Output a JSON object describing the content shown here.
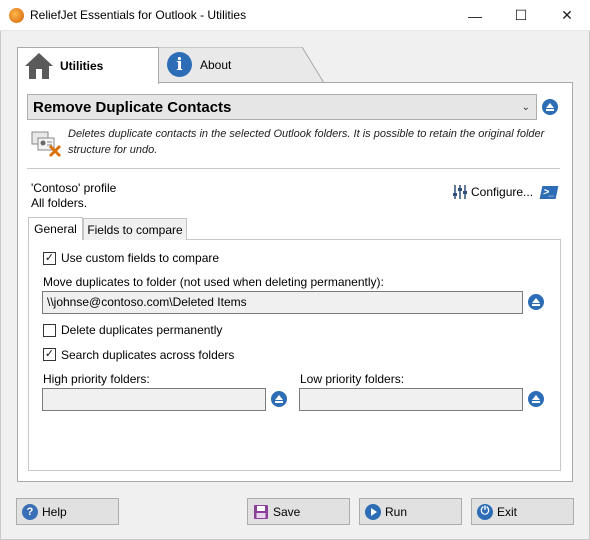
{
  "window": {
    "title": "ReliefJet Essentials for Outlook - Utilities",
    "minimize_glyph": "—",
    "maximize_glyph": "☐",
    "close_glyph": "✕"
  },
  "main_tabs": [
    {
      "label": "Utilities",
      "icon": "home-icon",
      "active": true
    },
    {
      "label": "About",
      "icon": "info-icon",
      "active": false
    }
  ],
  "utility": {
    "selected": "Remove Duplicate Contacts",
    "description": "Deletes duplicate contacts in the selected Outlook folders. It is possible to retain the original folder structure for undo.",
    "icon": "contacts-remove-icon"
  },
  "profile": {
    "line1": "'Contoso' profile",
    "line2": "All folders.",
    "configure_label": "Configure..."
  },
  "sub_tabs": [
    {
      "label": "General",
      "active": true
    },
    {
      "label": "Fields to compare",
      "active": false
    }
  ],
  "general": {
    "use_custom_fields": {
      "label": "Use custom fields to compare",
      "checked": true
    },
    "move_to_label": "Move duplicates to folder (not used when deleting permanently):",
    "move_to_value": "\\\\johnse@contoso.com\\Deleted Items",
    "delete_permanently": {
      "label": "Delete duplicates permanently",
      "checked": false
    },
    "search_across": {
      "label": "Search duplicates across folders",
      "checked": true
    },
    "high_priority_label": "High priority folders:",
    "high_priority_value": "",
    "low_priority_label": "Low priority folders:",
    "low_priority_value": ""
  },
  "buttons": {
    "help": "Help",
    "save": "Save",
    "run": "Run",
    "exit": "Exit"
  },
  "colors": {
    "accent_blue": "#2d6db5",
    "help_icon": "#3a6fb5",
    "save_icon": "#8a3f9a",
    "run_icon": "#2d6db5",
    "exit_icon": "#2d6db5"
  }
}
